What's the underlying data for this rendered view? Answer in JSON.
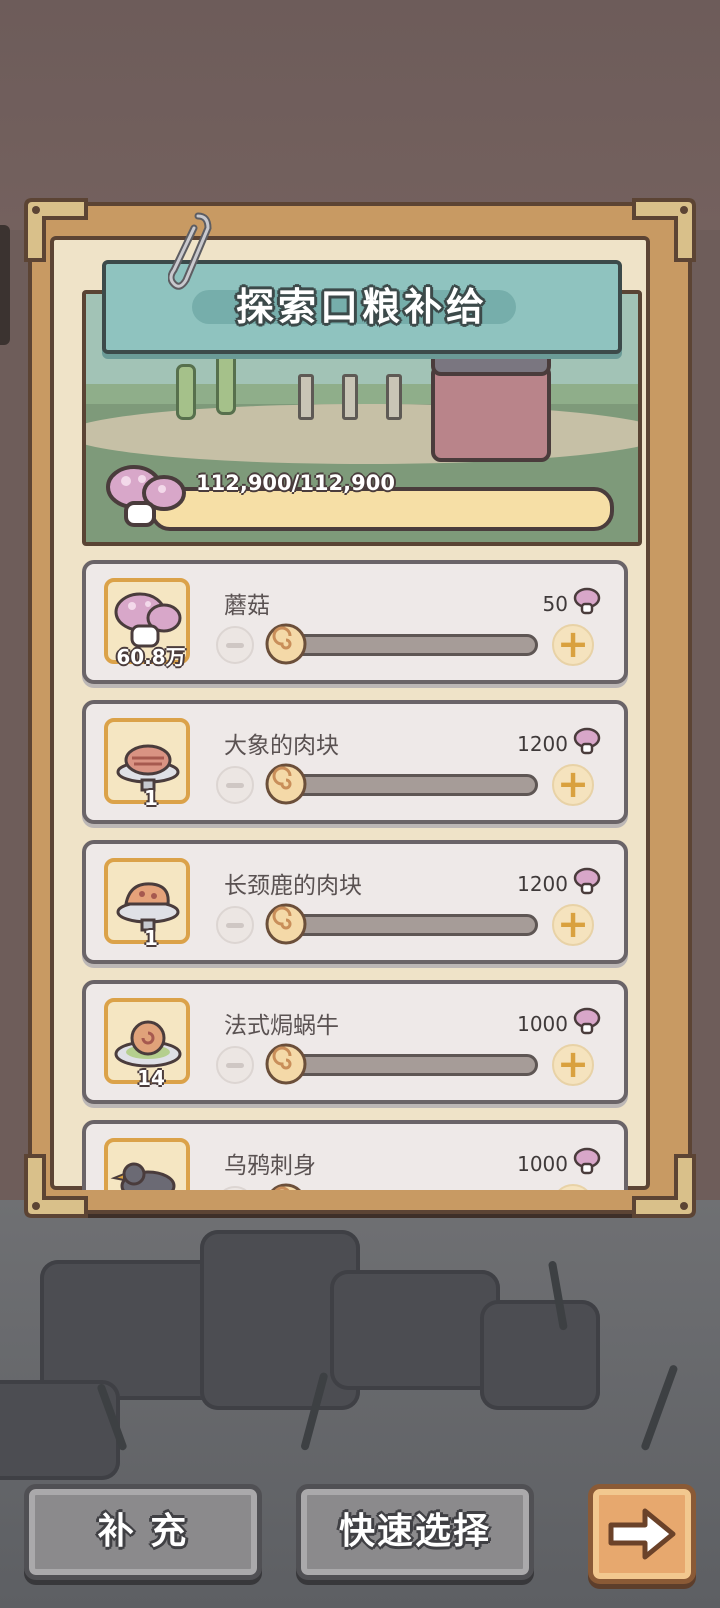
{
  "title": "探索口粮补给",
  "capacity": {
    "text": "112,900/112,900",
    "fill": 1.0
  },
  "items": [
    {
      "name": "蘑菇",
      "count": "60.8万",
      "price": "50",
      "icon": "mushroom-icon"
    },
    {
      "name": "大象的肉块",
      "count": "1",
      "price": "1200",
      "icon": "elephant-meat-icon"
    },
    {
      "name": "长颈鹿的肉块",
      "count": "1",
      "price": "1200",
      "icon": "giraffe-meat-icon"
    },
    {
      "name": "法式焗蜗牛",
      "count": "14",
      "price": "1000",
      "icon": "escargot-icon"
    },
    {
      "name": "乌鸦刺身",
      "count": "",
      "price": "1000",
      "icon": "crow-sashimi-icon"
    }
  ],
  "buttons": {
    "refill": "补 充",
    "quick_select": "快速选择",
    "next_icon": "arrow-right-icon"
  },
  "colors": {
    "accent": "#dba249",
    "banner": "#8fc3bf",
    "bar": "#f6dfa6"
  }
}
